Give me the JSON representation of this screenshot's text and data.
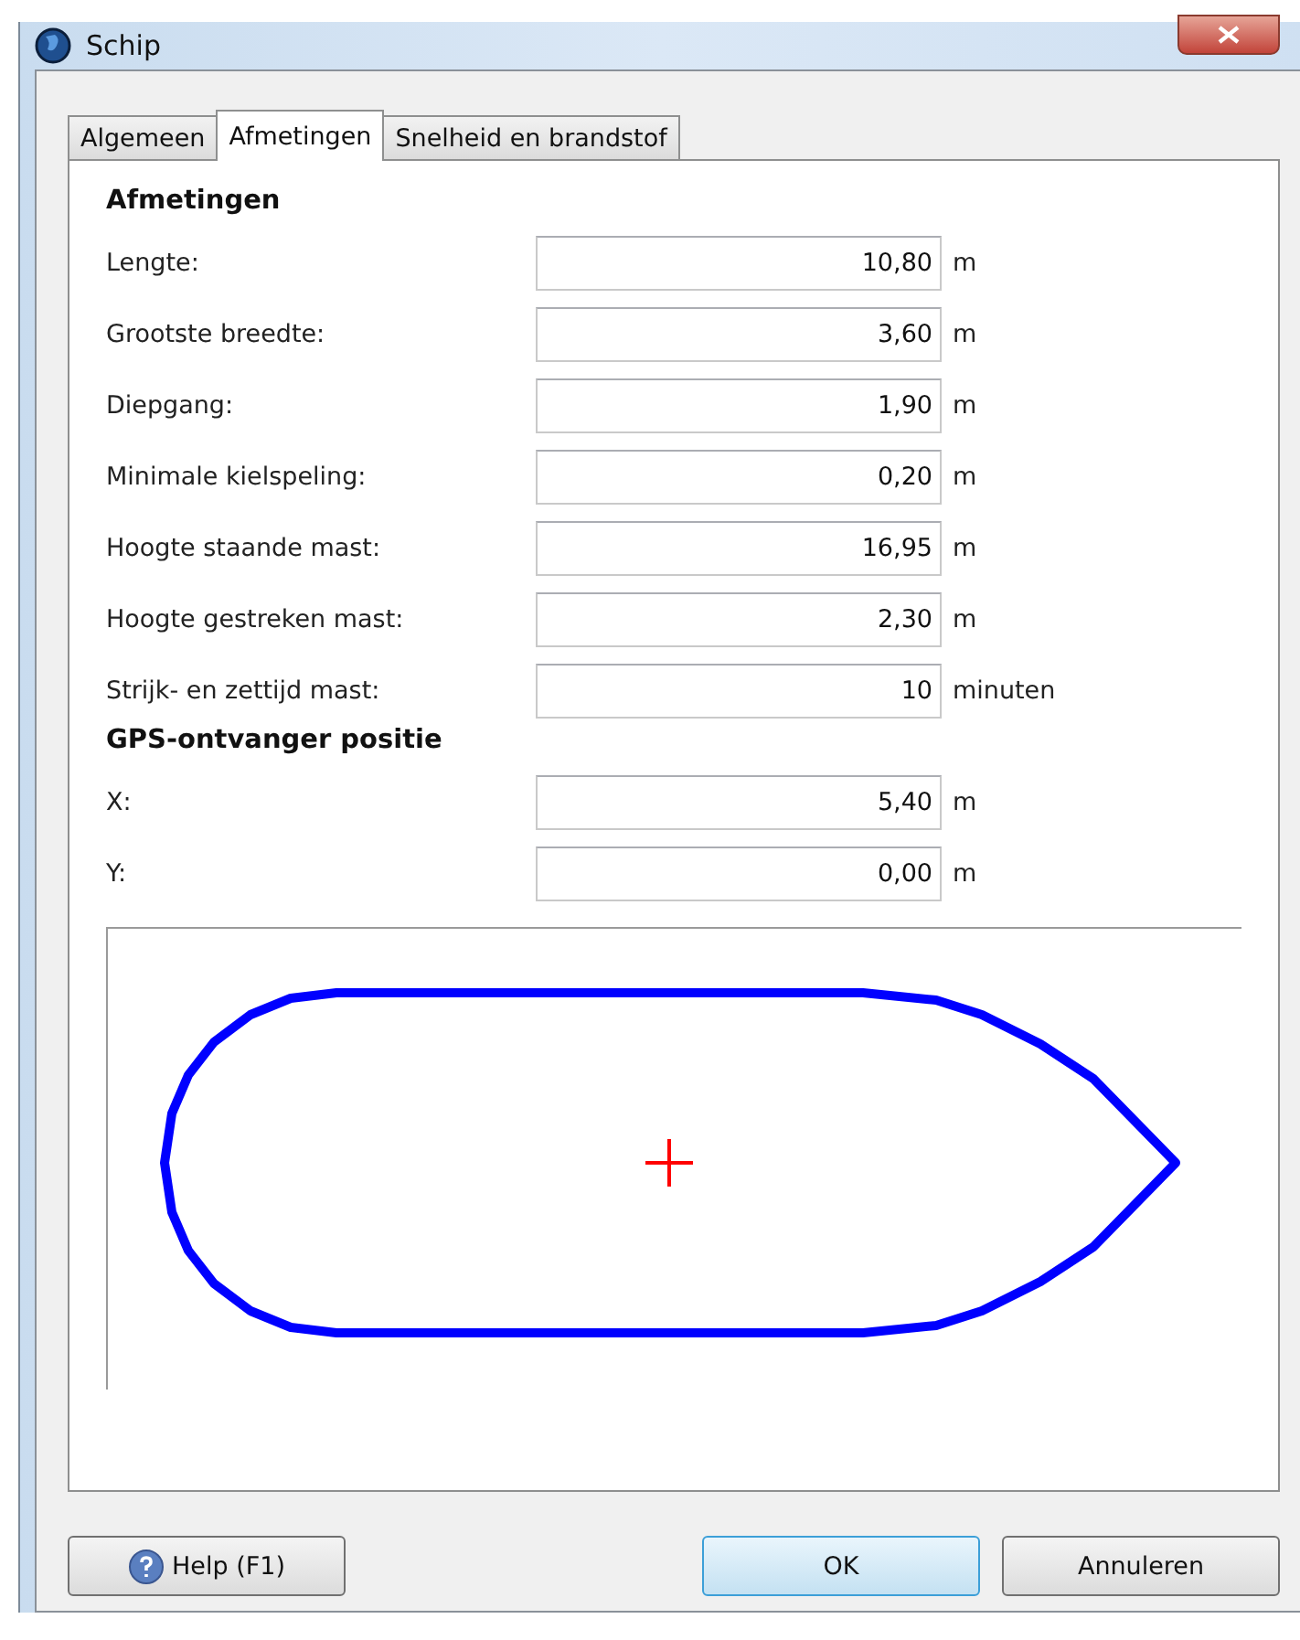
{
  "window": {
    "title": "Schip"
  },
  "tabs": [
    {
      "label": "Algemeen",
      "selected": false
    },
    {
      "label": "Afmetingen",
      "selected": true
    },
    {
      "label": "Snelheid en brandstof",
      "selected": false
    }
  ],
  "sections": [
    {
      "title": "Afmetingen",
      "fields": [
        {
          "label": "Lengte:",
          "value": "10,80",
          "unit": "m"
        },
        {
          "label": "Grootste breedte:",
          "value": "3,60",
          "unit": "m"
        },
        {
          "label": "Diepgang:",
          "value": "1,90",
          "unit": "m"
        },
        {
          "label": "Minimale kielspeling:",
          "value": "0,20",
          "unit": "m"
        },
        {
          "label": "Hoogte staande mast:",
          "value": "16,95",
          "unit": "m"
        },
        {
          "label": "Hoogte gestreken mast:",
          "value": "2,30",
          "unit": "m"
        },
        {
          "label": "Strijk- en zettijd mast:",
          "value": "10",
          "unit": "minuten"
        }
      ]
    },
    {
      "title": "GPS-ontvanger positie",
      "fields": [
        {
          "label": "X:",
          "value": "5,40",
          "unit": "m"
        },
        {
          "label": "Y:",
          "value": "0,00",
          "unit": "m"
        }
      ]
    }
  ],
  "buttons": [
    {
      "label": "Help (F1)",
      "kind": "help",
      "default": false
    },
    {
      "label": "OK",
      "kind": "plain",
      "default": true
    },
    {
      "label": "Annuleren",
      "kind": "plain",
      "default": false
    }
  ]
}
